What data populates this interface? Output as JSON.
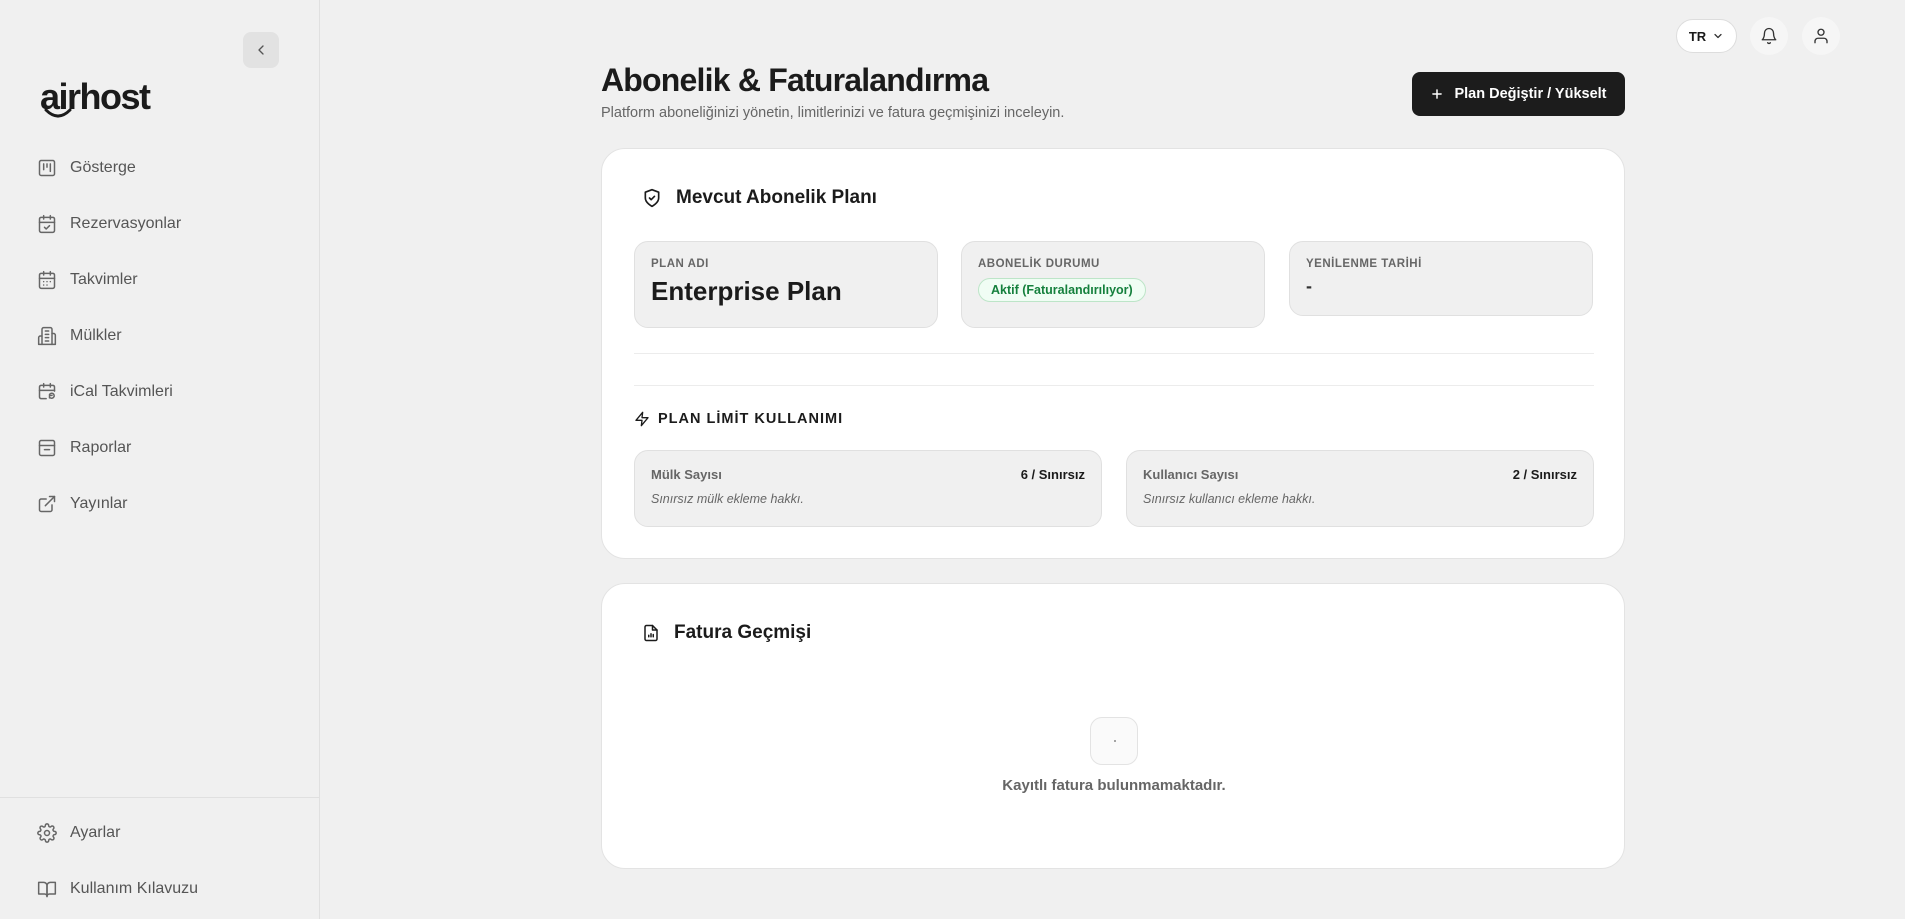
{
  "app": {
    "logo": "airhost",
    "lang": "TR"
  },
  "sidebar": {
    "items": [
      {
        "label": "Gösterge",
        "icon": "dashboard-icon"
      },
      {
        "label": "Rezervasyonlar",
        "icon": "calendar-check-icon"
      },
      {
        "label": "Takvimler",
        "icon": "calendar-icon"
      },
      {
        "label": "Mülkler",
        "icon": "building-icon"
      },
      {
        "label": "iCal Takvimleri",
        "icon": "calendar-sync-icon"
      },
      {
        "label": "Raporlar",
        "icon": "archive-icon"
      },
      {
        "label": "Yayınlar",
        "icon": "external-link-icon"
      }
    ],
    "bottom": [
      {
        "label": "Ayarlar",
        "icon": "gear-icon"
      },
      {
        "label": "Kullanım Kılavuzu",
        "icon": "book-icon"
      }
    ]
  },
  "header": {
    "title": "Abonelik & Faturalandırma",
    "subtitle": "Platform aboneliğinizi yönetin, limitlerinizi ve fatura geçmişinizi inceleyin.",
    "primary_button": "Plan Değiştir / Yükselt"
  },
  "subscription": {
    "title": "Mevcut Abonelik Planı",
    "plan_label": "PLAN ADI",
    "plan_value": "Enterprise Plan",
    "status_label": "ABONELİK DURUMU",
    "status_value": "Aktif (Faturalandırılıyor)",
    "renewal_label": "YENİLENME TARİHİ",
    "renewal_value": "-",
    "limits_title": "PLAN LİMİT KULLANIMI",
    "limits": [
      {
        "label": "Mülk Sayısı",
        "value": "6 / Sınırsız",
        "note": "Sınırsız mülk ekleme hakkı."
      },
      {
        "label": "Kullanıcı Sayısı",
        "value": "2 / Sınırsız",
        "note": "Sınırsız kullanıcı ekleme hakkı."
      }
    ]
  },
  "invoices": {
    "title": "Fatura Geçmişi",
    "empty_text": "Kayıtlı fatura bulunmamaktadır."
  },
  "colors": {
    "primary": "#1c1c1c",
    "badge_green": "#15803d",
    "background": "#f0f0f0"
  }
}
